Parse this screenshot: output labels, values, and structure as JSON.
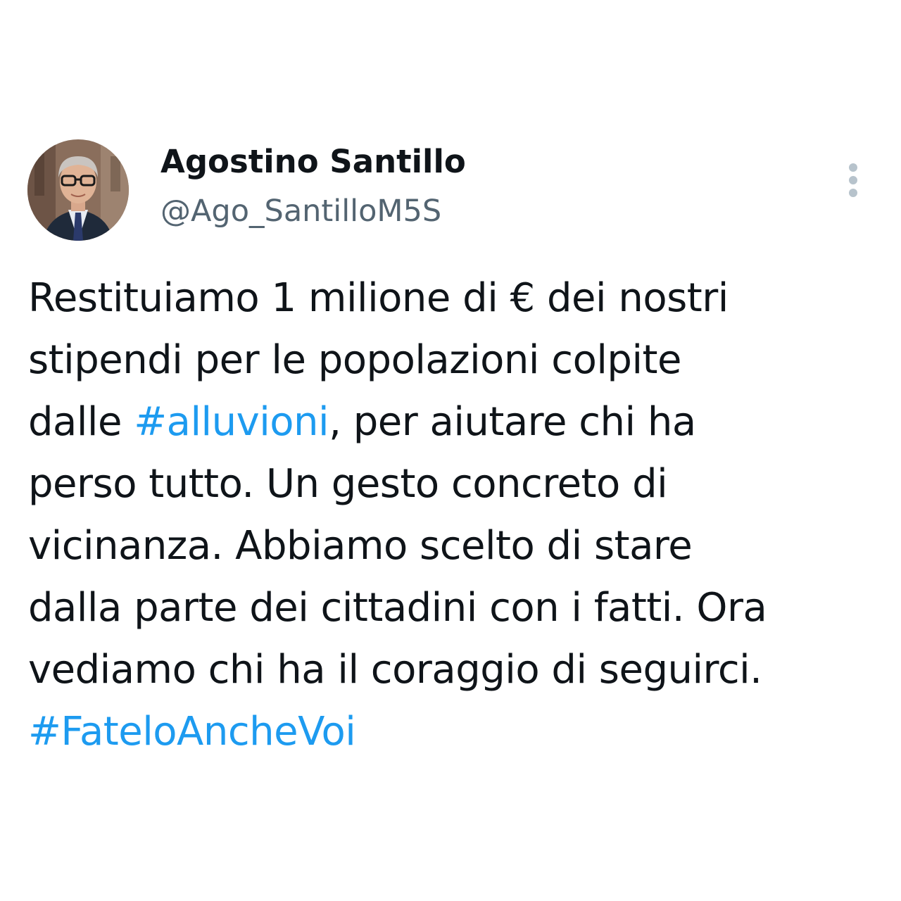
{
  "author": {
    "name": "Agostino Santillo",
    "handle": "@Ago_SantilloM5S"
  },
  "menu_icon": "more-vertical-icon",
  "colors": {
    "text": "#0f1419",
    "handle": "#536471",
    "hashtag": "#1d9bf0",
    "menu_dots": "#b7c3cc",
    "background": "#ffffff"
  },
  "tweet": {
    "line1": "Restituiamo 1 milione di € dei nostri",
    "line2": "stipendi per le popolazioni colpite",
    "line3_pre": "dalle ",
    "hashtag1": "#alluvioni",
    "line3_post": ", per aiutare chi ha",
    "line4": "perso tutto. Un gesto concreto di",
    "line5": "vicinanza. Abbiamo scelto di stare",
    "line6": "dalla parte dei cittadini con i fatti. Ora",
    "line7": "vediamo chi ha il coraggio di seguirci.",
    "hashtag2": "#FateloAncheVoi"
  }
}
